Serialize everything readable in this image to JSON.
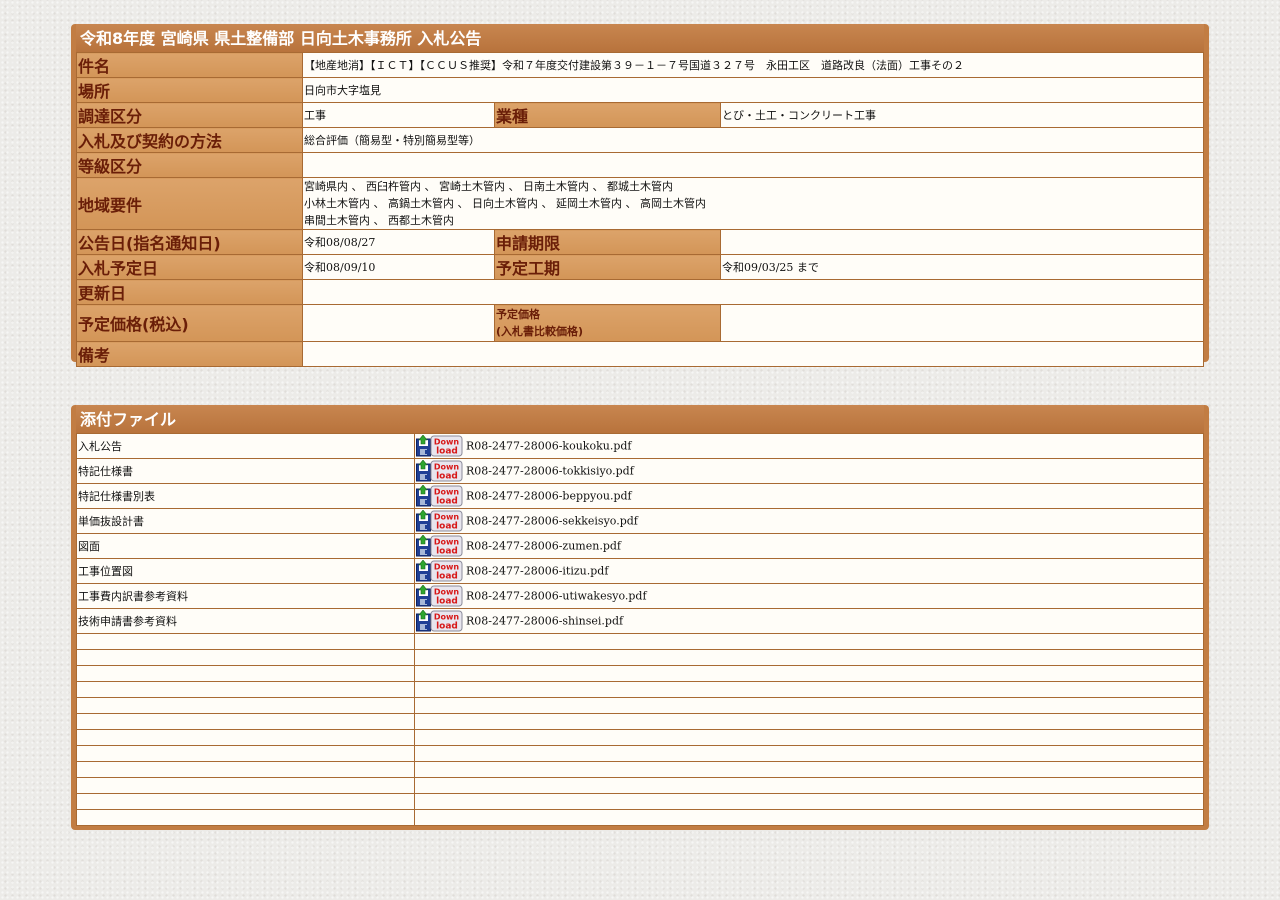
{
  "notice": {
    "title": "令和8年度 宮崎県 県土整備部 日向土木事務所 入札公告",
    "labels": {
      "name": "件名",
      "location": "場所",
      "category": "調達区分",
      "industry": "業種",
      "method": "入札及び契約の方法",
      "grade": "等級区分",
      "region": "地域要件",
      "announce_date": "公告日(指名通知日)",
      "application_deadline": "申請期限",
      "bid_date": "入札予定日",
      "construction_period": "予定工期",
      "updated": "更新日",
      "estimated_price": "予定価格(税込)",
      "estimated_price_compare_line1": "予定価格",
      "estimated_price_compare_line2": "(入札書比較価格)",
      "remarks": "備考"
    },
    "values": {
      "name": "【地産地消】【ＩＣＴ】【ＣＣＵＳ推奨】令和７年度交付建設第３９－１－７号国道３２７号　永田工区　道路改良（法面）工事その２",
      "location": "日向市大字塩見",
      "category": "工事",
      "industry": "とび・土工・コンクリート工事",
      "method": "総合評価（簡易型・特別簡易型等）",
      "grade": "",
      "region_line1": "宮崎県内 、 西臼杵管内 、 宮崎土木管内 、 日南土木管内 、 都城土木管内",
      "region_line2": "小林土木管内 、 高鍋土木管内 、 日向土木管内 、 延岡土木管内 、 高岡土木管内",
      "region_line3": "串間土木管内 、 西都土木管内",
      "announce_date": "令和08/08/27",
      "application_deadline": "",
      "bid_date": "令和08/09/10",
      "construction_period": "令和09/03/25 まで",
      "updated": "",
      "estimated_price": "",
      "estimated_price_compare": "",
      "remarks": ""
    }
  },
  "attachments": {
    "title": "添付ファイル",
    "download_icon_text_top": "Down",
    "download_icon_text_bottom": "load",
    "files": [
      {
        "desc": "入札公告",
        "file": "R08-2477-28006-koukoku.pdf"
      },
      {
        "desc": "特記仕様書",
        "file": "R08-2477-28006-tokkisiyo.pdf"
      },
      {
        "desc": "特記仕様書別表",
        "file": "R08-2477-28006-beppyou.pdf"
      },
      {
        "desc": "単価抜設計書",
        "file": "R08-2477-28006-sekkeisyo.pdf"
      },
      {
        "desc": "図面",
        "file": "R08-2477-28006-zumen.pdf"
      },
      {
        "desc": "工事位置図",
        "file": "R08-2477-28006-itizu.pdf"
      },
      {
        "desc": "工事費内訳書参考資料",
        "file": "R08-2477-28006-utiwakesyo.pdf"
      },
      {
        "desc": "技術申請書参考資料",
        "file": "R08-2477-28006-shinsei.pdf"
      }
    ],
    "empty_row_count": 12
  }
}
